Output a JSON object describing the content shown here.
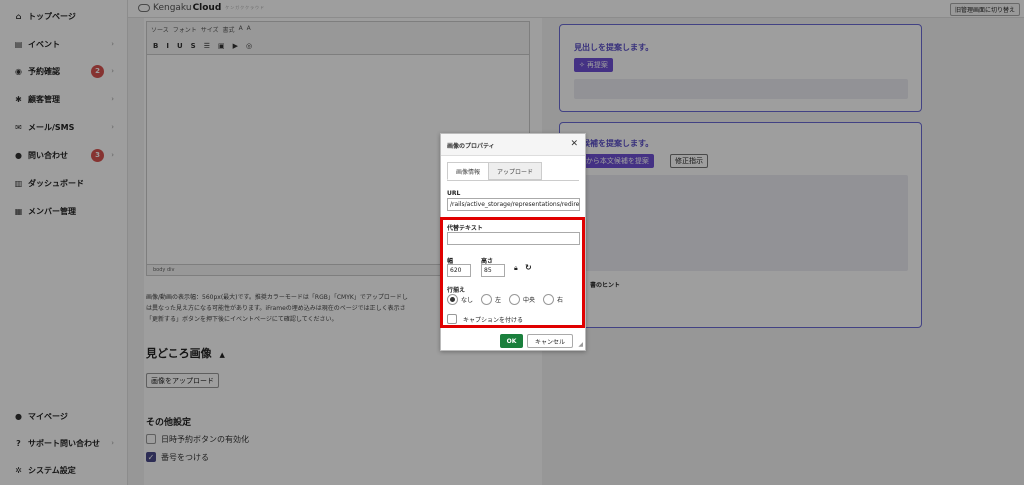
{
  "sidebar": {
    "items": [
      {
        "label": "トップページ",
        "icon": "home-icon",
        "glyph": "⌂",
        "arrow": ""
      },
      {
        "label": "イベント",
        "icon": "document-icon",
        "glyph": "▤",
        "arrow": "›"
      },
      {
        "label": "予約確認",
        "icon": "database-icon",
        "glyph": "◉",
        "arrow": "›",
        "badge": "2"
      },
      {
        "label": "顧客管理",
        "icon": "users-icon",
        "glyph": "✱",
        "arrow": "›"
      },
      {
        "label": "メール/SMS",
        "icon": "mail-icon",
        "glyph": "✉",
        "arrow": "›"
      },
      {
        "label": "問い合わせ",
        "icon": "chat-icon",
        "glyph": "●",
        "arrow": "›",
        "badge": "3"
      },
      {
        "label": "ダッシュボード",
        "icon": "dashboard-icon",
        "glyph": "▥",
        "arrow": ""
      },
      {
        "label": "メンバー管理",
        "icon": "grid-icon",
        "glyph": "▦",
        "arrow": ""
      }
    ],
    "bottom": [
      {
        "label": "マイページ",
        "icon": "user-icon",
        "glyph": "●",
        "arrow": ""
      },
      {
        "label": "サポート問い合わせ",
        "icon": "help-icon",
        "glyph": "?",
        "arrow": "›"
      },
      {
        "label": "システム設定",
        "icon": "gear-icon",
        "glyph": "✲",
        "arrow": ""
      }
    ]
  },
  "header": {
    "logo_prefix": "Kengaku",
    "logo_bold": "Cloud",
    "logo_tag": "ケンガククラウド",
    "switch_label": "旧管理画面に切り替え"
  },
  "editor": {
    "toolbar_row1": [
      "ソース",
      "B",
      "I",
      "U",
      "S",
      "フォント",
      "サイズ",
      "書式",
      "A",
      "A"
    ],
    "toolbar_row2": [
      "B",
      "I",
      "U",
      "S",
      "☰",
      "▣",
      "▶",
      "◎"
    ],
    "status_path": "body  div",
    "note_lines": [
      "画像/動画の表示幅：560px(最大)です。推奨カラーモードは「RGB」「CMYK」でアップロードし",
      "は異なった見え方になる可能性があります。iFrameの埋め込みは現在のページでは正しく表示さ",
      "「更新する」ボタンを押下後にイベントページにて確認してください。"
    ]
  },
  "gallery": {
    "title": "見どころ画像",
    "toggle": "▲",
    "upload_label": "画像をアップロード"
  },
  "other": {
    "title": "その他設定",
    "options": [
      {
        "label": "日時予約ボタンの有効化",
        "checked": false
      },
      {
        "label": "番号をつける",
        "checked": true
      }
    ]
  },
  "ai_panel_1": {
    "title": "見出しを提案します。",
    "button": "再提案"
  },
  "ai_panel_2": {
    "title": "文候補を提案します。",
    "button": "AIから本文候補を提案",
    "revise_button": "修正指示",
    "hint": "書のヒント"
  },
  "dialog": {
    "title": "画像のプロパティ",
    "close": "✕",
    "tabs": [
      "画像情報",
      "アップロード"
    ],
    "url_label": "URL",
    "url_value": "/rails/active_storage/representations/redirect",
    "alt_label": "代替テキスト",
    "alt_value": "",
    "width_label": "幅",
    "width_value": "620",
    "height_label": "高さ",
    "height_value": "85",
    "align_label": "行揃え",
    "align_options": [
      "なし",
      "左",
      "中央",
      "右"
    ],
    "align_selected": "なし",
    "caption_label": "キャプションを付ける",
    "ok": "OK",
    "cancel": "キャンセル"
  }
}
